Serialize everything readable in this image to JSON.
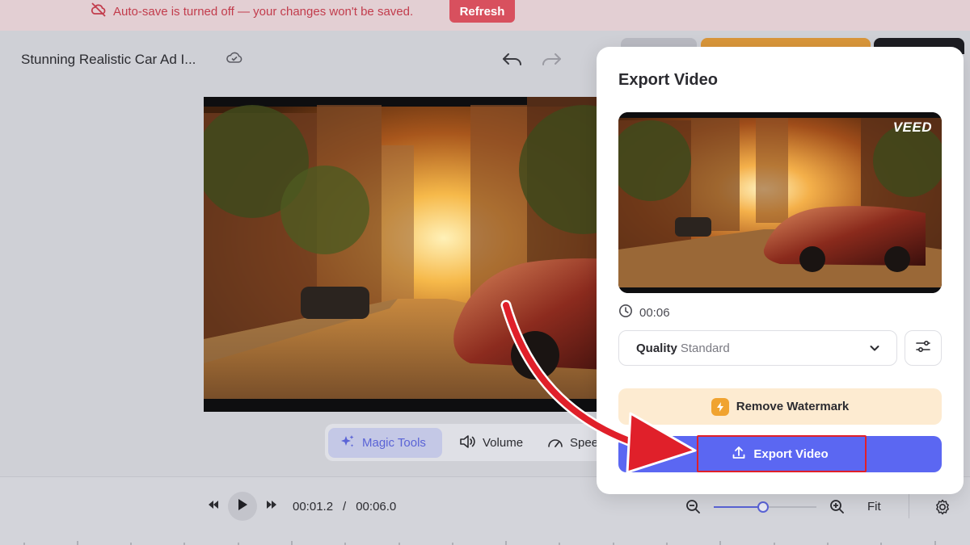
{
  "banner": {
    "message": "Auto-save is turned off — your changes won't be saved.",
    "refresh_label": "Refresh"
  },
  "header": {
    "project_title": "Stunning Realistic Car Ad I..."
  },
  "toolbar": {
    "magic_tools_label": "Magic Tools",
    "volume_label": "Volume",
    "speed_label": "Spee"
  },
  "playback": {
    "current_time": "00:01.2",
    "separator": "/",
    "total_time": "00:06.0",
    "fit_label": "Fit",
    "zoom_level_fraction": 0.48
  },
  "export_panel": {
    "title": "Export Video",
    "watermark_text": "VEED",
    "duration": "00:06",
    "quality_label": "Quality",
    "quality_value": "Standard",
    "remove_watermark_label": "Remove Watermark",
    "export_button_label": "Export Video"
  },
  "colors": {
    "accent": "#5b67f2",
    "banner_text": "#c23c4c",
    "refresh_bg": "#d8505e",
    "watermark_bg": "#fdebd1",
    "bolt": "#f0a330",
    "annotation_red": "#e0202a"
  },
  "icons": {
    "banner": "cloud-off-icon",
    "cloud": "cloud-check-icon",
    "undo": "undo-icon",
    "redo": "redo-icon",
    "magic": "sparkles-icon",
    "volume": "speaker-icon",
    "speed": "speedometer-icon",
    "clock": "clock-icon",
    "chevron": "chevron-down-icon",
    "sliders": "sliders-icon",
    "bolt": "lightning-icon",
    "upload": "upload-icon"
  }
}
